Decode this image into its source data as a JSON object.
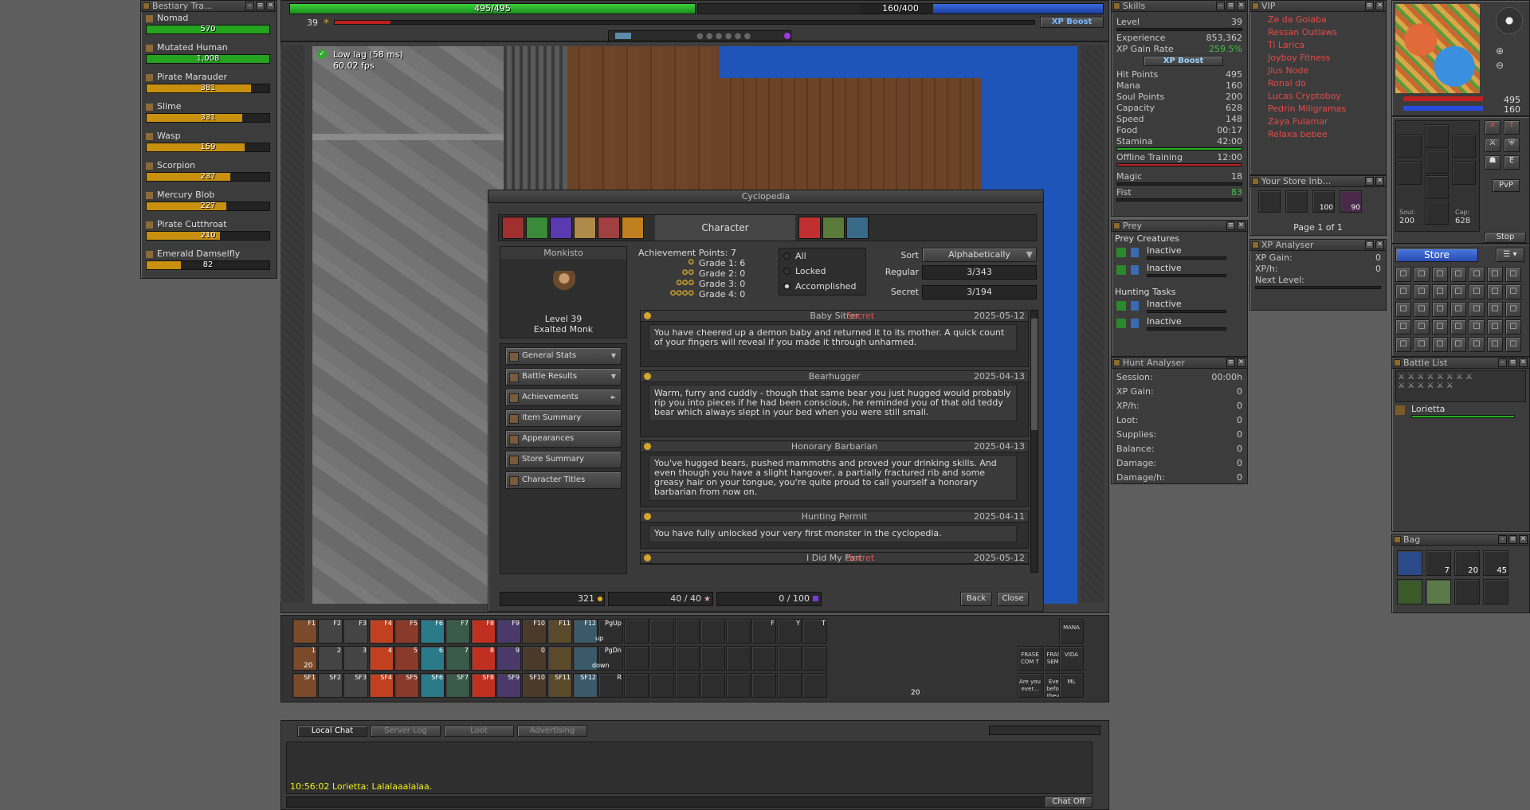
{
  "bestiary": {
    "title": "Bestiary Tra...",
    "entries": [
      {
        "name": "Nomad",
        "value": "570",
        "fill": 1.0,
        "color": "#23a31e"
      },
      {
        "name": "Mutated Human",
        "value": "1,008",
        "fill": 1.0,
        "color": "#23a31e"
      },
      {
        "name": "Pirate Marauder",
        "value": "381",
        "fill": 0.85,
        "color": "#c8900e"
      },
      {
        "name": "Slime",
        "value": "331",
        "fill": 0.78,
        "color": "#c8900e"
      },
      {
        "name": "Wasp",
        "value": "159",
        "fill": 0.8,
        "color": "#c8900e"
      },
      {
        "name": "Scorpion",
        "value": "237",
        "fill": 0.68,
        "color": "#c8900e"
      },
      {
        "name": "Mercury Blob",
        "value": "227",
        "fill": 0.65,
        "color": "#c8900e"
      },
      {
        "name": "Pirate Cutthroat",
        "value": "210",
        "fill": 0.6,
        "color": "#c8900e"
      },
      {
        "name": "Emerald Damselfly",
        "value": "82",
        "fill": 0.28,
        "color": "#c8900e"
      }
    ]
  },
  "top": {
    "hp": "495/495",
    "mana": "160/400",
    "level": "39",
    "xp_boost": "XP Boost"
  },
  "game": {
    "lag": "Low lag (58 ms)",
    "fps": "60.02 fps"
  },
  "skills": {
    "title": "Skills",
    "rows": [
      {
        "k": "Level",
        "v": "39"
      },
      {
        "k": "Experience",
        "v": "853,362"
      },
      {
        "k": "XP Gain Rate",
        "v": "259.5%"
      }
    ],
    "boost": "XP Boost",
    "rows2": [
      {
        "k": "Hit Points",
        "v": "495"
      },
      {
        "k": "Mana",
        "v": "160"
      },
      {
        "k": "Soul Points",
        "v": "200"
      },
      {
        "k": "Capacity",
        "v": "628"
      },
      {
        "k": "Speed",
        "v": "148"
      },
      {
        "k": "Food",
        "v": "00:17"
      },
      {
        "k": "Stamina",
        "v": "42:00"
      }
    ],
    "offline": {
      "k": "Offline Training",
      "v": "12:00"
    },
    "rows3": [
      {
        "k": "Magic",
        "v": "18"
      },
      {
        "k": "Fist",
        "v": "83"
      }
    ]
  },
  "vip": {
    "title": "VIP",
    "names": [
      "Ze da Goiaba",
      "Ressan Outlaws",
      "Ti Larica",
      "Joyboy Fitness",
      "Jius Node",
      "Ronal do",
      "Lucas Cryptoboy",
      "Pedrin Miligramas",
      "Zaya Fulamar",
      "Relaxa bebee"
    ]
  },
  "store_inbox": {
    "title": "Your Store Inb...",
    "page": "Page 1 of 1",
    "counts": [
      "100",
      "90"
    ]
  },
  "xp_analyser": {
    "title": "XP Analyser",
    "rows": [
      {
        "k": "XP Gain:",
        "v": "0"
      },
      {
        "k": "XP/h:",
        "v": "0"
      },
      {
        "k": "Next Level:",
        "v": ""
      }
    ]
  },
  "prey": {
    "title": "Prey",
    "creatures_label": "Prey Creatures",
    "creatures": [
      "Inactive",
      "Inactive"
    ],
    "tasks_label": "Hunting Tasks",
    "tasks": [
      "Inactive",
      "Inactive"
    ]
  },
  "hunt": {
    "title": "Hunt Analyser",
    "rows": [
      {
        "k": "Session:",
        "v": "00:00h"
      },
      {
        "k": "XP Gain:",
        "v": "0"
      },
      {
        "k": "XP/h:",
        "v": "0"
      },
      {
        "k": "Loot:",
        "v": "0"
      },
      {
        "k": "Supplies:",
        "v": "0"
      },
      {
        "k": "Balance:",
        "v": "0"
      },
      {
        "k": "Damage:",
        "v": "0"
      },
      {
        "k": "Damage/h:",
        "v": "0"
      }
    ]
  },
  "minimap": {
    "hp": "495",
    "mana": "160"
  },
  "equip": {
    "soul_label": "Soul:",
    "soul": "200",
    "cap_label": "Cap:",
    "cap": "628",
    "stop": "Stop",
    "store": "Store",
    "pvp": "PvP"
  },
  "battle": {
    "title": "Battle List",
    "entry": "Lorietta"
  },
  "bag": {
    "title": "Bag",
    "counts": [
      "7",
      "20",
      "45"
    ]
  },
  "cyclo": {
    "title": "Cyclopedia",
    "tab": "Character",
    "char_name": "Monkisto",
    "char_level": "Level 39",
    "char_voc": "Exalted Monk",
    "points": "Achievement Points: 7",
    "grades": [
      "Grade 1: 6",
      "Grade 2: 0",
      "Grade 3: 0",
      "Grade 4: 0"
    ],
    "filters": [
      "All",
      "Locked",
      "Accomplished"
    ],
    "sort_label": "Sort",
    "sort_value": "Alphabetically",
    "regular_label": "Regular",
    "regular": "3/343",
    "secret_label": "Secret",
    "secret": "3/194",
    "menu": [
      "General Stats",
      "Battle Results",
      "Achievements",
      "Item Summary",
      "Appearances",
      "Store Summary",
      "Character Titles"
    ],
    "achievements": [
      {
        "name": "Baby Sitter",
        "secret": "Secret",
        "date": "2025-05-12",
        "text": "You have cheered up a demon baby and returned it to its mother. A quick count of your fingers will reveal if you made it through unharmed."
      },
      {
        "name": "Bearhugger",
        "secret": "",
        "date": "2025-04-13",
        "text": "Warm, furry and cuddly - though that same bear you just hugged would probably rip you into pieces if he had been conscious, he reminded you of that old teddy bear which always slept in your bed when you were still small."
      },
      {
        "name": "Honorary Barbarian",
        "secret": "",
        "date": "2025-04-13",
        "text": "You've hugged bears, pushed mammoths and proved your drinking skills. And even though you have a slight hangover, a partially fractured rib and some greasy hair on your tongue, you're quite proud to call yourself a honorary barbarian from now on."
      },
      {
        "name": "Hunting Permit",
        "secret": "",
        "date": "2025-04-11",
        "text": "You have fully unlocked your very first monster in the cyclopedia."
      },
      {
        "name": "I Did My Part",
        "secret": "Secret",
        "date": "2025-05-12",
        "text": ""
      }
    ],
    "gold": "321",
    "charms": "40 / 40",
    "tokens": "0 / 100",
    "back": "Back",
    "close": "Close"
  },
  "hotkeys": {
    "row1": [
      "F1",
      "F2",
      "F3",
      "F4",
      "F5",
      "F6",
      "F7",
      "F8",
      "F9",
      "F10",
      "F11",
      "F12",
      "PgUp",
      "",
      "",
      "",
      "",
      "",
      "F",
      "Y",
      "T"
    ],
    "row2": [
      "1",
      "2",
      "3",
      "4",
      "5",
      "6",
      "7",
      "8",
      "9",
      "0",
      "",
      "",
      "PgDn",
      "",
      "",
      "",
      "",
      "",
      "",
      "",
      ""
    ],
    "row3": [
      "SF1",
      "SF2",
      "SF3",
      "SF4",
      "SF5",
      "SF6",
      "SF7",
      "SF8",
      "SF9",
      "SF10",
      "SF11",
      "SF12",
      "R",
      "",
      "",
      "",
      "",
      "",
      "",
      "",
      ""
    ],
    "labels": [
      "MANA",
      "FRASE COM T",
      "FRASE SEM T",
      "VIDA",
      "Are you ever...",
      "Even before they...",
      "ML"
    ],
    "count1": "20",
    "count2": "20",
    "up_label": "up",
    "down_label": "down"
  },
  "chat": {
    "tabs": [
      "Local Chat",
      "Server Log",
      "Loot",
      "Advertising"
    ],
    "message": "10:56:02 Lorietta: Lalalaaalalaa.",
    "chat_off": "Chat Off"
  }
}
